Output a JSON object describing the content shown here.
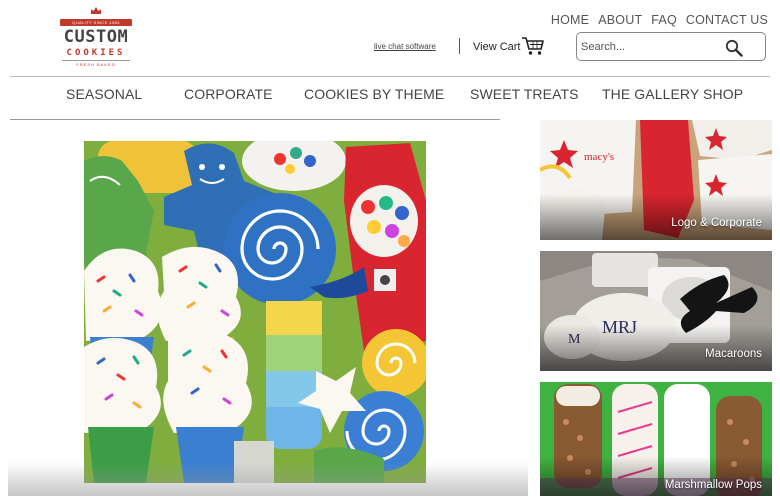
{
  "logo": {
    "top_text": "QUALITY SINCE 1983",
    "line1": "CUSTOM",
    "line2": "COOKIES",
    "tagline": "FRESH BAKED"
  },
  "top_nav": [
    "HOME",
    "ABOUT",
    "FAQ",
    "CONTACT US"
  ],
  "live_chat": "live chat software",
  "cart": {
    "label": "View Cart"
  },
  "search": {
    "placeholder": "Search..."
  },
  "main_nav": [
    "SEASONAL",
    "CORPORATE",
    "COOKIES BY THEME",
    "SWEET TREATS",
    "THE GALLERY SHOP"
  ],
  "tiles": [
    {
      "label": "Logo & Corporate",
      "cookie_text": "macy's"
    },
    {
      "label": "Macaroons",
      "monogram": "MRJ"
    },
    {
      "label": "Marshmallow Pops"
    }
  ],
  "colors": {
    "brand_red": "#c0392b",
    "nav_text": "#444444"
  }
}
